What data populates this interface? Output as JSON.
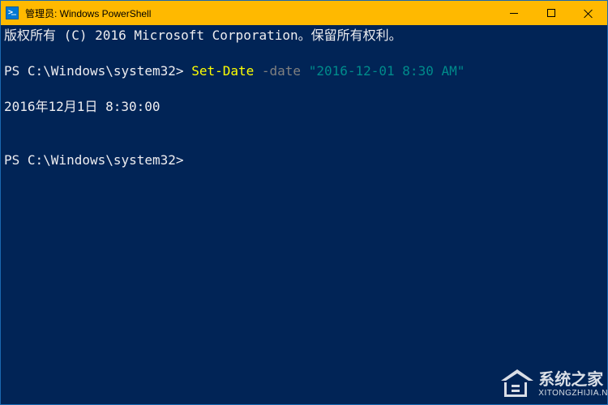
{
  "titlebar": {
    "title": "管理员: Windows PowerShell"
  },
  "terminal": {
    "line1": "版权所有 (C) 2016 Microsoft Corporation。保留所有权利。",
    "prompt1_path": "PS C:\\Windows\\system32> ",
    "command": "Set-Date",
    "space1": " ",
    "param": "-date",
    "space2": " ",
    "arg": "\"2016-12-01 8:30 AM\"",
    "output": "2016年12月1日 8:30:00",
    "prompt2_path": "PS C:\\Windows\\system32>"
  },
  "watermark": {
    "main": "系统之家",
    "sub": "XITONGZHIJIA.N"
  }
}
